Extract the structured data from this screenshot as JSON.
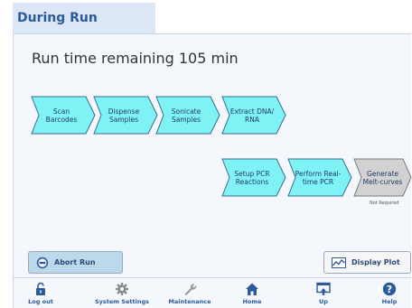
{
  "header": {
    "title": "During Run"
  },
  "status": {
    "run_time": "Run time remaining 105 min"
  },
  "steps_row1": [
    {
      "label": "Scan\nBarcodes",
      "color": "#7ff2f5"
    },
    {
      "label": "Dispense\nSamples",
      "color": "#7ff2f5"
    },
    {
      "label": "Sonicate\nSamples",
      "color": "#7ff2f5"
    },
    {
      "label": "Extract DNA/\nRNA",
      "color": "#7ff2f5"
    }
  ],
  "steps_row2": [
    {
      "label": "Setup PCR\nReactions",
      "color": "#7ff2f5"
    },
    {
      "label": "Perform Real-\ntime PCR",
      "color": "#7ff2f5"
    },
    {
      "label": "Generate\nMelt-curves",
      "color": "#d2d2d2",
      "note": "Not Required"
    }
  ],
  "buttons": {
    "abort": "Abort Run",
    "display_plot": "Display Plot"
  },
  "nav": [
    {
      "label": "Log out",
      "icon": "lock-icon"
    },
    {
      "label": "System Settings",
      "icon": "gear-icon"
    },
    {
      "label": "Maintenance",
      "icon": "wrench-icon"
    },
    {
      "label": "Home",
      "icon": "home-icon"
    },
    {
      "label": "Up",
      "icon": "up-icon"
    },
    {
      "label": "Help",
      "icon": "help-icon"
    }
  ],
  "colors": {
    "accent": "#2d5b9a",
    "step_active": "#7ff2f5",
    "step_inactive": "#d2d2d2",
    "abort_bg": "#bcd9ec"
  }
}
